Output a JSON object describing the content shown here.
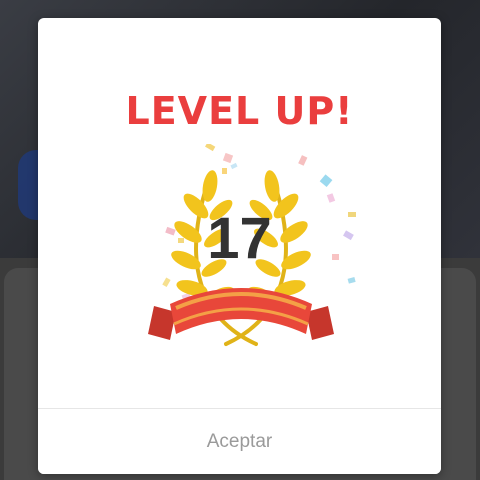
{
  "modal": {
    "title": "LEVEL UP!",
    "level": "17",
    "accept_label": "Aceptar"
  },
  "colors": {
    "title": "#ea3e3e",
    "laurel": "#f2c41d",
    "ribbon": "#e8473a",
    "button_text": "#9a9a9a"
  },
  "icons": [
    "laurel-wreath-icon",
    "ribbon-banner-icon",
    "confetti-icon"
  ]
}
